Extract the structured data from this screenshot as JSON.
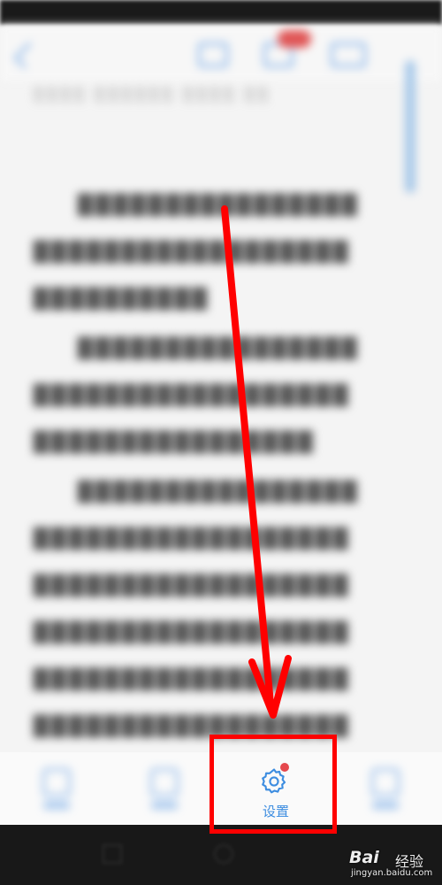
{
  "bottom_bar": {
    "settings_label": "设置"
  },
  "watermark": {
    "brand": "Bai",
    "cn": "经验",
    "url": "jingyan.baidu.com"
  },
  "colors": {
    "accent": "#3d8de0",
    "highlight": "#ff0000",
    "badge": "#e5484d"
  }
}
